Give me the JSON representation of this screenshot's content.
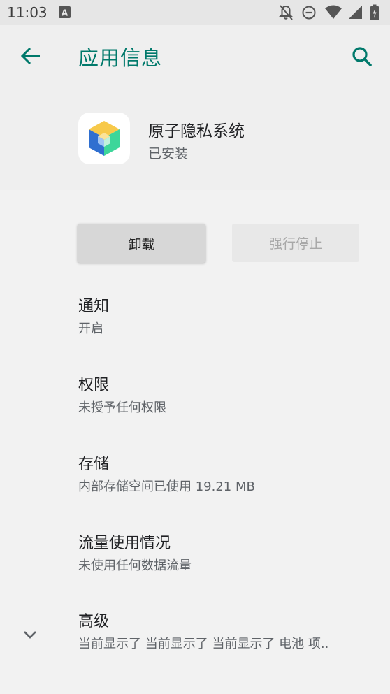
{
  "status_bar": {
    "time": "11:03",
    "icons": [
      "a-notification-icon",
      "notifications-off-icon",
      "do-not-disturb-icon",
      "wifi-icon",
      "cell-signal-icon",
      "battery-icon"
    ]
  },
  "header": {
    "title": "应用信息",
    "back_icon": "arrow-back-icon",
    "search_icon": "search-icon"
  },
  "app": {
    "name": "原子隐私系统",
    "status": "已安装"
  },
  "buttons": {
    "uninstall": "卸载",
    "force_stop": "强行停止"
  },
  "settings": [
    {
      "title": "通知",
      "subtitle": "开启"
    },
    {
      "title": "权限",
      "subtitle": "未授予任何权限"
    },
    {
      "title": "存储",
      "subtitle": "内部存储空间已使用 19.21 MB"
    },
    {
      "title": "流量使用情况",
      "subtitle": "未使用任何数据流量"
    },
    {
      "title": "高级",
      "subtitle": "当前显示了 当前显示了 当前显示了 电池 项.."
    }
  ],
  "colors": {
    "accent": "#00796b",
    "background": "#f2f2f2",
    "status_bar": "#e6e6e6"
  }
}
